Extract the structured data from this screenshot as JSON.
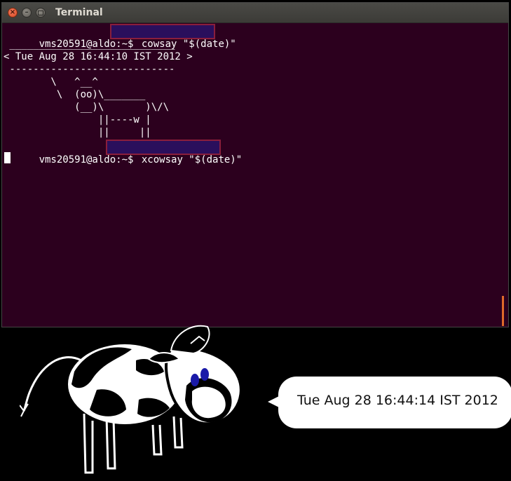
{
  "window": {
    "title": "Terminal",
    "close_glyph": "×",
    "min_glyph": "–"
  },
  "terminal": {
    "prompt": "vms20591@aldo:~$ ",
    "command1": "cowsay \"$(date)\"",
    "output": [
      " ____________________________",
      "< Tue Aug 28 16:44:10 IST 2012 >",
      " ----------------------------",
      "        \\   ^__^",
      "         \\  (oo)\\_______",
      "            (__)\\       )\\/\\",
      "                ||----w |",
      "                ||     ||"
    ],
    "command2": "xcowsay \"$(date)\""
  },
  "xcowsay": {
    "bubble_text": "Tue Aug 28 16:44:14 IST 2012"
  },
  "colors": {
    "terminal_bg": "#2c001e",
    "highlight_border": "#8a1e3c",
    "highlight_fill": "#2a0f5c",
    "scrollbar": "#e06a2a"
  }
}
